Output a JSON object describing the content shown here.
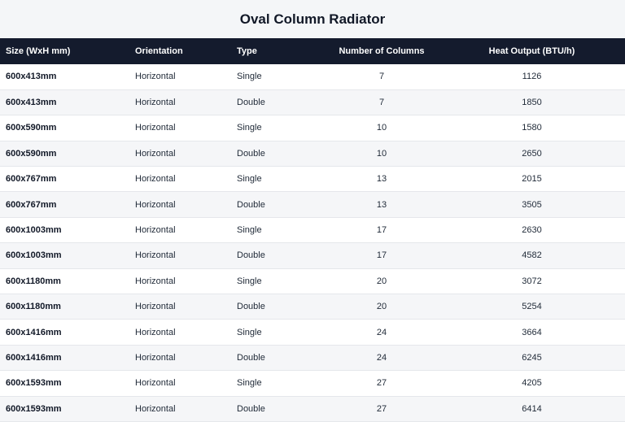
{
  "title": "Oval Column Radiator",
  "columns": [
    "Size (WxH mm)",
    "Orientation",
    "Type",
    "Number of Columns",
    "Heat Output (BTU/h)"
  ],
  "rows": [
    {
      "size": "600x413mm",
      "orientation": "Horizontal",
      "type": "Single",
      "columns": "7",
      "heat_output": "1126"
    },
    {
      "size": "600x413mm",
      "orientation": "Horizontal",
      "type": "Double",
      "columns": "7",
      "heat_output": "1850"
    },
    {
      "size": "600x590mm",
      "orientation": "Horizontal",
      "type": "Single",
      "columns": "10",
      "heat_output": "1580"
    },
    {
      "size": "600x590mm",
      "orientation": "Horizontal",
      "type": "Double",
      "columns": "10",
      "heat_output": "2650"
    },
    {
      "size": "600x767mm",
      "orientation": "Horizontal",
      "type": "Single",
      "columns": "13",
      "heat_output": "2015"
    },
    {
      "size": "600x767mm",
      "orientation": "Horizontal",
      "type": "Double",
      "columns": "13",
      "heat_output": "3505"
    },
    {
      "size": "600x1003mm",
      "orientation": "Horizontal",
      "type": "Single",
      "columns": "17",
      "heat_output": "2630"
    },
    {
      "size": "600x1003mm",
      "orientation": "Horizontal",
      "type": "Double",
      "columns": "17",
      "heat_output": "4582"
    },
    {
      "size": "600x1180mm",
      "orientation": "Horizontal",
      "type": "Single",
      "columns": "20",
      "heat_output": "3072"
    },
    {
      "size": "600x1180mm",
      "orientation": "Horizontal",
      "type": "Double",
      "columns": "20",
      "heat_output": "5254"
    },
    {
      "size": "600x1416mm",
      "orientation": "Horizontal",
      "type": "Single",
      "columns": "24",
      "heat_output": "3664"
    },
    {
      "size": "600x1416mm",
      "orientation": "Horizontal",
      "type": "Double",
      "columns": "24",
      "heat_output": "6245"
    },
    {
      "size": "600x1593mm",
      "orientation": "Horizontal",
      "type": "Single",
      "columns": "27",
      "heat_output": "4205"
    },
    {
      "size": "600x1593mm",
      "orientation": "Horizontal",
      "type": "Double",
      "columns": "27",
      "heat_output": "6414"
    }
  ],
  "colors": {
    "header_bg": "#141b2d",
    "title_bg": "#f4f6f8",
    "stripe_bg": "#f5f6f8"
  }
}
